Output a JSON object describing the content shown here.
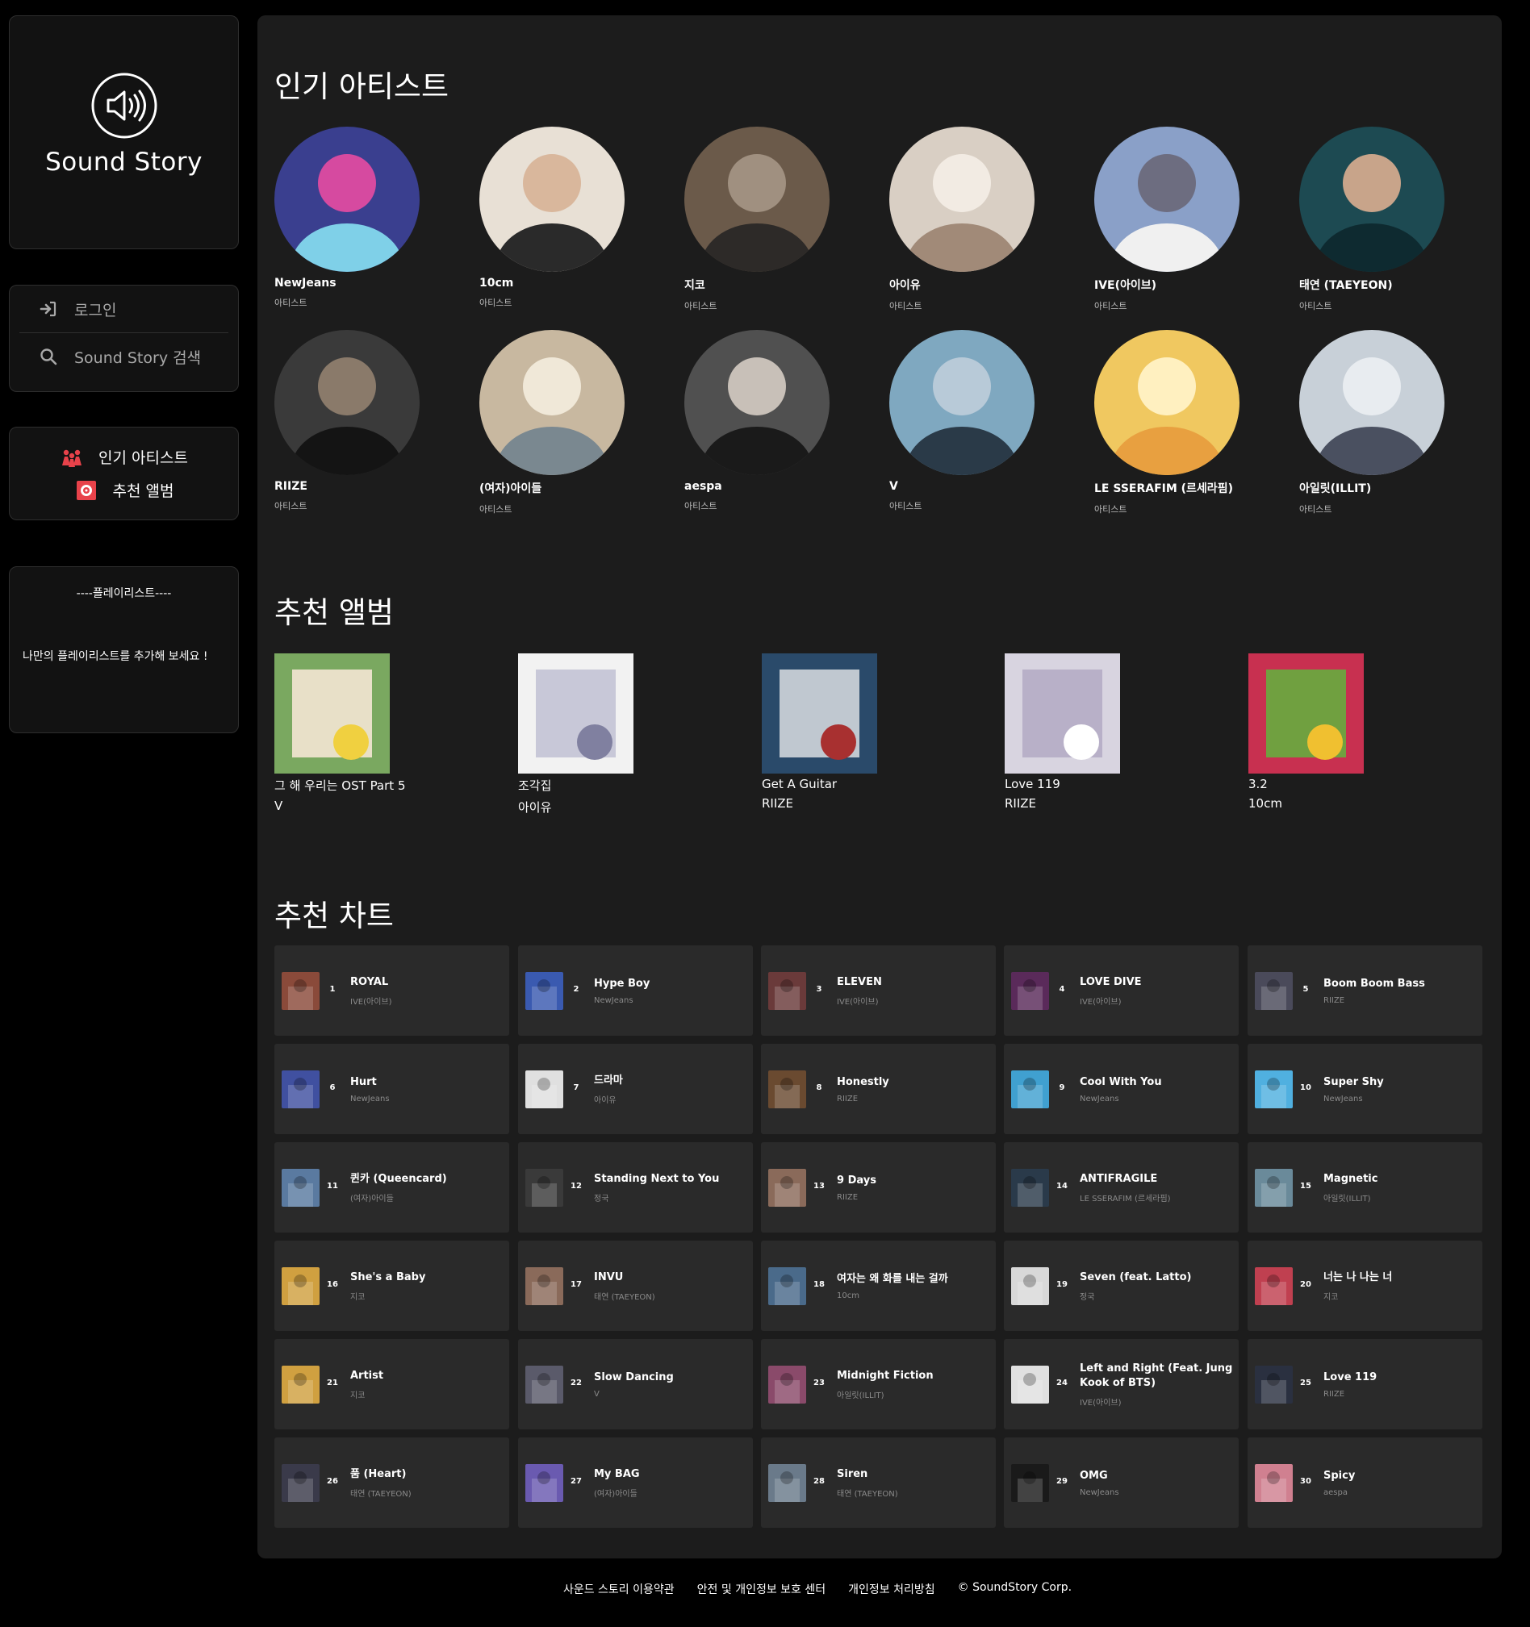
{
  "sidebar": {
    "logo_text": "Sound Story",
    "nav": {
      "login": "로그인",
      "search": "Sound Story 검색"
    },
    "menu": {
      "popular_artists": "인기 아티스트",
      "recommended_albums": "추천 앨범"
    },
    "playlist": {
      "title": "----플레이리스트----",
      "description": "나만의 플레이리스트를 추가해 보세요 !"
    }
  },
  "main": {
    "artists_title": "인기 아티스트",
    "albums_title": "추천 앨범",
    "charts_title": "추천 차트",
    "artists": [
      {
        "name": "NewJeans",
        "type": "아티스트"
      },
      {
        "name": "10cm",
        "type": "아티스트"
      },
      {
        "name": "지코",
        "type": "아티스트"
      },
      {
        "name": "아이유",
        "type": "아티스트"
      },
      {
        "name": "IVE(아이브)",
        "type": "아티스트"
      },
      {
        "name": "태연 (TAEYEON)",
        "type": "아티스트"
      },
      {
        "name": "RIIZE",
        "type": "아티스트"
      },
      {
        "name": "(여자)아이들",
        "type": "아티스트"
      },
      {
        "name": "aespa",
        "type": "아티스트"
      },
      {
        "name": "V",
        "type": "아티스트"
      },
      {
        "name": "LE SSERAFIM (르세라핌)",
        "type": "아티스트"
      },
      {
        "name": "아일릿(ILLIT)",
        "type": "아티스트"
      }
    ],
    "albums": [
      {
        "title": "그 해 우리는 OST Part 5",
        "artist": "V"
      },
      {
        "title": "조각집",
        "artist": "아이유"
      },
      {
        "title": "Get A Guitar",
        "artist": "RIIZE"
      },
      {
        "title": "Love 119",
        "artist": "RIIZE"
      },
      {
        "title": "3.2",
        "artist": "10cm"
      }
    ],
    "charts": [
      {
        "rank": "1",
        "title": "ROYAL",
        "artist": "IVE(아이브)"
      },
      {
        "rank": "2",
        "title": "Hype Boy",
        "artist": "NewJeans"
      },
      {
        "rank": "3",
        "title": "ELEVEN",
        "artist": "IVE(아이브)"
      },
      {
        "rank": "4",
        "title": "LOVE DIVE",
        "artist": "IVE(아이브)"
      },
      {
        "rank": "5",
        "title": "Boom Boom Bass",
        "artist": "RIIZE"
      },
      {
        "rank": "6",
        "title": "Hurt",
        "artist": "NewJeans"
      },
      {
        "rank": "7",
        "title": "드라마",
        "artist": "아이유"
      },
      {
        "rank": "8",
        "title": "Honestly",
        "artist": "RIIZE"
      },
      {
        "rank": "9",
        "title": "Cool With You",
        "artist": "NewJeans"
      },
      {
        "rank": "10",
        "title": "Super Shy",
        "artist": "NewJeans"
      },
      {
        "rank": "11",
        "title": "퀸카 (Queencard)",
        "artist": "(여자)아이들"
      },
      {
        "rank": "12",
        "title": "Standing Next to You",
        "artist": "정국"
      },
      {
        "rank": "13",
        "title": "9 Days",
        "artist": "RIIZE"
      },
      {
        "rank": "14",
        "title": "ANTIFRAGILE",
        "artist": "LE SSERAFIM (르세라핌)"
      },
      {
        "rank": "15",
        "title": "Magnetic",
        "artist": "아일릿(ILLIT)"
      },
      {
        "rank": "16",
        "title": "She's a Baby",
        "artist": "지코"
      },
      {
        "rank": "17",
        "title": "INVU",
        "artist": "태연 (TAEYEON)"
      },
      {
        "rank": "18",
        "title": "여자는 왜 화를 내는 걸까",
        "artist": "10cm"
      },
      {
        "rank": "19",
        "title": "Seven (feat. Latto)",
        "artist": "정국"
      },
      {
        "rank": "20",
        "title": "너는 나 나는 너",
        "artist": "지코"
      },
      {
        "rank": "21",
        "title": "Artist",
        "artist": "지코"
      },
      {
        "rank": "22",
        "title": "Slow Dancing",
        "artist": "V"
      },
      {
        "rank": "23",
        "title": "Midnight Fiction",
        "artist": "아일릿(ILLIT)"
      },
      {
        "rank": "24",
        "title": "Left and Right (Feat. Jung Kook of BTS)",
        "artist": "IVE(아이브)"
      },
      {
        "rank": "25",
        "title": "Love 119",
        "artist": "RIIZE"
      },
      {
        "rank": "26",
        "title": "품 (Heart)",
        "artist": "태연 (TAEYEON)"
      },
      {
        "rank": "27",
        "title": "My BAG",
        "artist": "(여자)아이들"
      },
      {
        "rank": "28",
        "title": "Siren",
        "artist": "태연 (TAEYEON)"
      },
      {
        "rank": "29",
        "title": "OMG",
        "artist": "NewJeans"
      },
      {
        "rank": "30",
        "title": "Spicy",
        "artist": "aespa"
      }
    ]
  },
  "footer": {
    "terms": "사운드 스토리 이용약관",
    "safety": "안전 및 개인정보 보호 센터",
    "privacy": "개인정보 처리방침",
    "copyright": "© SoundStory Corp."
  },
  "colors": {
    "background": "#000000",
    "panel": "#121212",
    "main": "#1c1c1c",
    "card": "#2a2a2a",
    "accent": "#e8424a"
  }
}
